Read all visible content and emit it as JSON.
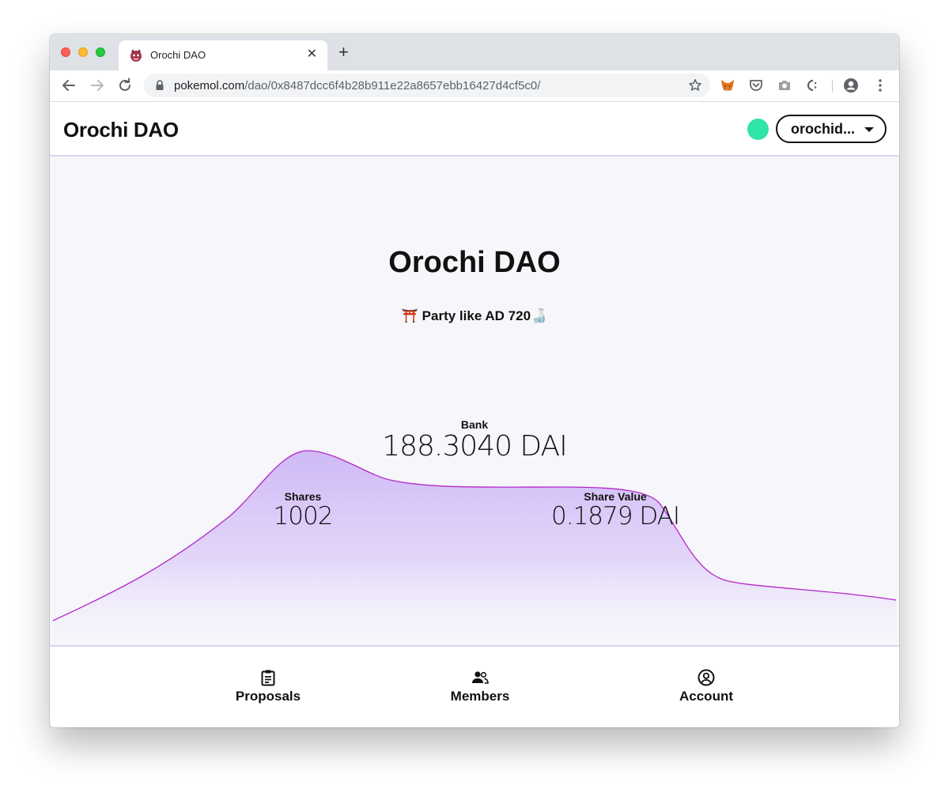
{
  "browser": {
    "tab_title": "Orochi DAO",
    "url_host": "pokemol.com",
    "url_path": "/dao/0x8487dcc6f4b28b911e22a8657ebb16427d4cf5c0/"
  },
  "header": {
    "brand": "Orochi DAO",
    "account_label": "orochid...",
    "status_color": "#2ee5a6"
  },
  "main": {
    "title": "Orochi DAO",
    "description": "⛩️ Party like AD 720🍶",
    "bank": {
      "label": "Bank",
      "value": "188.3040 DAI"
    },
    "shares": {
      "label": "Shares",
      "value": "1002"
    },
    "share_value": {
      "label": "Share Value",
      "value": "0.1879 DAI"
    },
    "graph_colors": {
      "line": "#b428c8",
      "fill_top": "#cdb6f6",
      "fill_bottom": "#f6f6fb"
    }
  },
  "bottom_nav": {
    "items": [
      {
        "label": "Proposals",
        "icon": "clipboard-icon"
      },
      {
        "label": "Members",
        "icon": "people-icon"
      },
      {
        "label": "Account",
        "icon": "user-circle-icon"
      }
    ]
  }
}
